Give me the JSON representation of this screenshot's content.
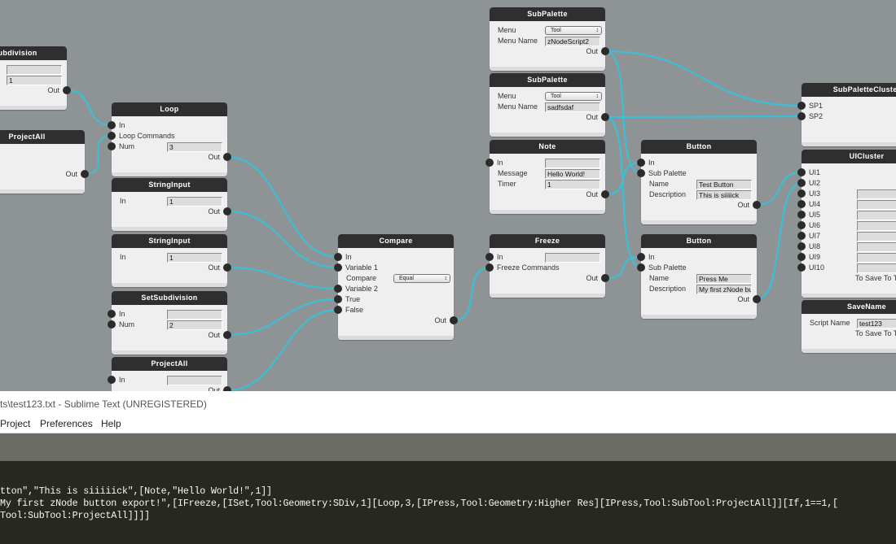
{
  "colors": {
    "wire": "#3bbfd6",
    "canvas": "#8e9396",
    "node_header": "#2f2f2f",
    "editor_bg": "#272822"
  },
  "nodes": [
    {
      "title": "SetSubdivision",
      "rows": [
        {
          "label": "In",
          "field": ""
        },
        {
          "label": "Num",
          "field": "1"
        },
        {
          "label": "Out",
          "out": true
        }
      ]
    },
    {
      "title": "ProjectAll",
      "rows": [
        {
          "label": ""
        },
        {
          "label": ""
        },
        {
          "label": "Out",
          "out": true
        }
      ]
    },
    {
      "title": "Loop",
      "rows": [
        {
          "label": "In",
          "in": true
        },
        {
          "label": "Loop Commands",
          "in": true
        },
        {
          "label": "Num",
          "in": true,
          "field": "3"
        },
        {
          "label": "Out",
          "out": true
        }
      ]
    },
    {
      "title": "StringInput",
      "rows": [
        {
          "label": "In",
          "field": "1"
        },
        {
          "label": "Out",
          "out": true
        }
      ]
    },
    {
      "title": "StringInput",
      "rows": [
        {
          "label": "In",
          "field": "1"
        },
        {
          "label": "Out",
          "out": true
        }
      ]
    },
    {
      "title": "SetSubdivision",
      "rows": [
        {
          "label": "In",
          "in": true,
          "field": ""
        },
        {
          "label": "Num",
          "in": true,
          "field": "2"
        },
        {
          "label": "Out",
          "out": true
        }
      ]
    },
    {
      "title": "ProjectAll",
      "rows": [
        {
          "label": "In",
          "in": true,
          "field": ""
        },
        {
          "label": "Out",
          "out": true
        }
      ]
    },
    {
      "title": "Compare",
      "rows": [
        {
          "label": "In",
          "in": true
        },
        {
          "label": "Variable 1",
          "in": true
        },
        {
          "label": "Compare",
          "select": "Equal"
        },
        {
          "label": "Variable 2",
          "in": true
        },
        {
          "label": "True",
          "in": true
        },
        {
          "label": "False",
          "in": true
        },
        {
          "label": "Out",
          "out": true
        }
      ]
    },
    {
      "title": "SubPalette",
      "rows": [
        {
          "label": "Menu",
          "select": "Tool"
        },
        {
          "label": "Menu Name",
          "field": "zNodeScript2"
        },
        {
          "label": "Out",
          "out": true
        }
      ]
    },
    {
      "title": "SubPalette",
      "rows": [
        {
          "label": "Menu",
          "select": "Tool"
        },
        {
          "label": "Menu Name",
          "field": "sadfsdaf"
        },
        {
          "label": "Out",
          "out": true
        }
      ]
    },
    {
      "title": "Note",
      "rows": [
        {
          "label": "In",
          "in": true,
          "field": ""
        },
        {
          "label": "Message",
          "field": "Hello World!"
        },
        {
          "label": "Timer",
          "field": "1"
        },
        {
          "label": "Out",
          "out": true
        }
      ]
    },
    {
      "title": "Freeze",
      "rows": [
        {
          "label": "In",
          "in": true,
          "field": ""
        },
        {
          "label": "Freeze Commands",
          "in": true
        },
        {
          "label": "Out",
          "out": true
        }
      ]
    },
    {
      "title": "Button",
      "rows": [
        {
          "label": "In",
          "in": true
        },
        {
          "label": "Sub Palette",
          "in": true
        },
        {
          "label": "Name",
          "field": "Test Button"
        },
        {
          "label": "Description",
          "field": "This is siiiiick"
        },
        {
          "label": "Out",
          "out": true
        }
      ]
    },
    {
      "title": "Button",
      "rows": [
        {
          "label": "In",
          "in": true
        },
        {
          "label": "Sub Palette",
          "in": true
        },
        {
          "label": "Name",
          "field": "Press Me"
        },
        {
          "label": "Description",
          "field": "My first zNode button export!"
        },
        {
          "label": "Out",
          "out": true
        }
      ]
    },
    {
      "title": "SubPaletteCluster",
      "rows": [
        {
          "label": "SP1",
          "in": true
        },
        {
          "label": "SP2",
          "in": true
        },
        {
          "label": ""
        }
      ]
    },
    {
      "title": "UICluster",
      "rows": [
        {
          "label": "UI1",
          "in": true
        },
        {
          "label": "UI2",
          "in": true
        },
        {
          "label": "UI3",
          "in": true,
          "field": ""
        },
        {
          "label": "UI4",
          "in": true,
          "field": ""
        },
        {
          "label": "UI5",
          "in": true,
          "field": ""
        },
        {
          "label": "UI6",
          "in": true,
          "field": ""
        },
        {
          "label": "UI7",
          "in": true,
          "field": ""
        },
        {
          "label": "UI8",
          "in": true,
          "field": ""
        },
        {
          "label": "UI9",
          "in": true,
          "field": ""
        },
        {
          "label": "UI10",
          "in": true,
          "field": ""
        },
        {
          "label": "To Save To The Palette",
          "note": true
        }
      ]
    },
    {
      "title": "SaveName",
      "rows": [
        {
          "label": "Script Name",
          "field": "test123"
        },
        {
          "label": "To Save To The Palette",
          "note": true
        }
      ]
    }
  ],
  "editor": {
    "title": "ts\\test123.txt - Sublime Text (UNREGISTERED)",
    "menu": [
      "Project",
      "Preferences",
      "Help"
    ],
    "lines": [
      "tton\",\"This is siiiiick\",[Note,\"Hello World!\",1]]",
      "My first zNode button export!\",[IFreeze,[ISet,Tool:Geometry:SDiv,1][Loop,3,[IPress,Tool:Geometry:Higher Res][IPress,Tool:SubTool:ProjectAll]][If,1==1,[",
      "Tool:SubTool:ProjectAll]]]]"
    ]
  }
}
